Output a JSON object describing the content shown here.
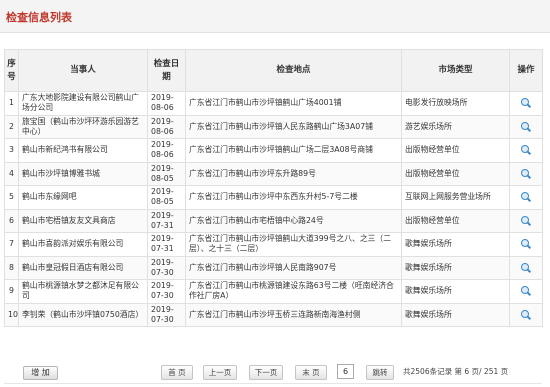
{
  "page_title": "检查信息列表",
  "table": {
    "headers": {
      "no": "序号",
      "party": "当事人",
      "date": "检查日期",
      "location": "检查地点",
      "market_type": "市场类型",
      "operation": "操作"
    },
    "rows": [
      {
        "no": "1",
        "party": "广东大地影院建设有限公司鹤山广场分公司",
        "date": "2019-08-06",
        "location": "广东省江门市鹤山市沙坪镇鹤山广场4001铺",
        "market_type": "电影发行放映场所"
      },
      {
        "no": "2",
        "party": "旅宝国（鹤山市沙坪环游乐园游艺中心）",
        "date": "2019-08-06",
        "location": "广东省江门市鹤山市沙坪镇人民东路鹤山广场3A07铺",
        "market_type": "游艺娱乐场所"
      },
      {
        "no": "3",
        "party": "鹤山市新纪鸿书有限公司",
        "date": "2019-08-06",
        "location": "广东省江门市鹤山市沙坪镇鹤山广场二层3A08号商铺",
        "market_type": "出版物经营单位"
      },
      {
        "no": "4",
        "party": "鹤山市沙坪镇博雅书城",
        "date": "2019-08-05",
        "location": "广东省江门市鹤山市沙坪东升路89号",
        "market_type": "出版物经营单位"
      },
      {
        "no": "5",
        "party": "鹤山市东缘网吧",
        "date": "2019-08-05",
        "location": "广东省江门市鹤山市沙坪中东西东升村5-7号二楼",
        "market_type": "互联网上网服务营业场所"
      },
      {
        "no": "6",
        "party": "鹤山市宅梧镇友友文具商店",
        "date": "2019-07-31",
        "location": "广东省江门市鹤山市宅梧镇中心路24号",
        "market_type": "出版物经营单位"
      },
      {
        "no": "7",
        "party": "鹤山市喜韵派对娱乐有限公司",
        "date": "2019-07-31",
        "location": "广东省江门市鹤山市沙坪镇鹤山大道399号之八、之三（二层）、之十三（二层）",
        "market_type": "歌舞娱乐场所"
      },
      {
        "no": "8",
        "party": "鹤山市皇冠假日酒店有限公司",
        "date": "2019-07-30",
        "location": "广东省江门市鹤山市沙坪镇人民南路907号",
        "market_type": "歌舞娱乐场所"
      },
      {
        "no": "9",
        "party": "鹤山市桃源镇水梦之都沐足有限公司",
        "date": "2019-07-30",
        "location": "广东省江门市鹤山市桃源镇建设东路63号二楼（旺南经济合作社厂房A）",
        "market_type": "歌舞娱乐场所"
      },
      {
        "no": "10",
        "party": "李钊荣（鹤山市沙坪镇0750酒店）",
        "date": "2019-07-30",
        "location": "广东省江门市鹤山市沙坪玉桥三连路新南海渔村侧",
        "market_type": "歌舞娱乐场所"
      }
    ]
  },
  "icons": {
    "view": "search-icon"
  },
  "pager": {
    "add_label": "增 加",
    "first": "首 页",
    "prev": "上一页",
    "next": "下一页",
    "last": "末 页",
    "page_input": "6",
    "go": "跳转",
    "info": "共2506条记录  第 6 页/ 251 页"
  },
  "colors": {
    "title": "#c0392b",
    "icon": "#3a86c8"
  }
}
